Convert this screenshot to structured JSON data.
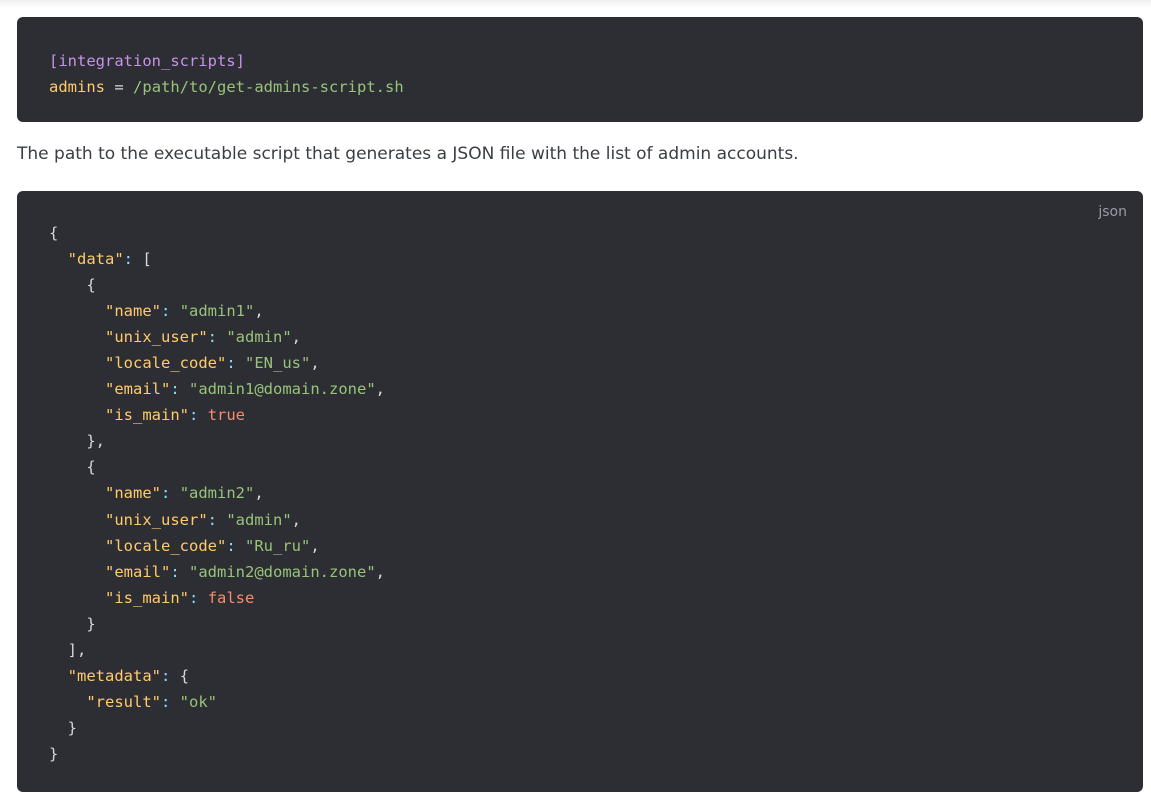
{
  "ini_snippet": {
    "section": "[integration_scripts]",
    "key": "admins",
    "operator": "=",
    "value": "/path/to/get-admins-script.sh"
  },
  "description": "The path to the executable script that generates a JSON file with the list of admin accounts.",
  "json_snippet": {
    "language_label": "json",
    "open_brace": "{",
    "close_brace": "}",
    "data_key": "\"data\"",
    "data_open": "[",
    "data_close": "],",
    "colon": ":",
    "comma": ",",
    "obj_open": "{",
    "obj1_close": "},",
    "obj2_close": "}",
    "admins": [
      {
        "name_key": "\"name\"",
        "name_value": "\"admin1\"",
        "unix_user_key": "\"unix_user\"",
        "unix_user_value": "\"admin\"",
        "locale_code_key": "\"locale_code\"",
        "locale_code_value": "\"EN_us\"",
        "email_key": "\"email\"",
        "email_value": "\"admin1@domain.zone\"",
        "is_main_key": "\"is_main\"",
        "is_main_value": "true"
      },
      {
        "name_key": "\"name\"",
        "name_value": "\"admin2\"",
        "unix_user_key": "\"unix_user\"",
        "unix_user_value": "\"admin\"",
        "locale_code_key": "\"locale_code\"",
        "locale_code_value": "\"Ru_ru\"",
        "email_key": "\"email\"",
        "email_value": "\"admin2@domain.zone\"",
        "is_main_key": "\"is_main\"",
        "is_main_value": "false"
      }
    ],
    "metadata_key": "\"metadata\"",
    "metadata_open": "{",
    "metadata_close": "}",
    "result_key": "\"result\"",
    "result_value": "\"ok\""
  },
  "colors": {
    "code_background": "#2d2e34",
    "key": "#ffcb6b",
    "string": "#98c379",
    "boolean": "#f78c6c",
    "section": "#c792ea"
  }
}
